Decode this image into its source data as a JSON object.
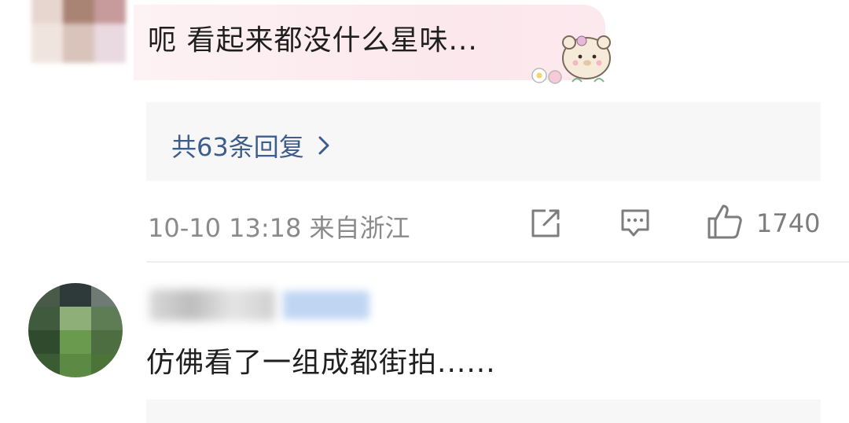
{
  "comments": [
    {
      "text": "呃 看起来都没什么星味...",
      "replies_label": "共63条回复",
      "timestamp": "10-10 13:18",
      "location": "来自浙江",
      "like_count": "1740"
    },
    {
      "text": "仿佛看了一组成都街拍......"
    }
  ],
  "icons": {
    "repost": "share-icon",
    "comment": "comment-icon",
    "like": "thumbs-up-icon",
    "replies_arrow": "chevron-right-icon"
  },
  "colors": {
    "link": "#3d5d8c",
    "meta": "#8a8a8a",
    "bubble": "#fbe7ec"
  }
}
